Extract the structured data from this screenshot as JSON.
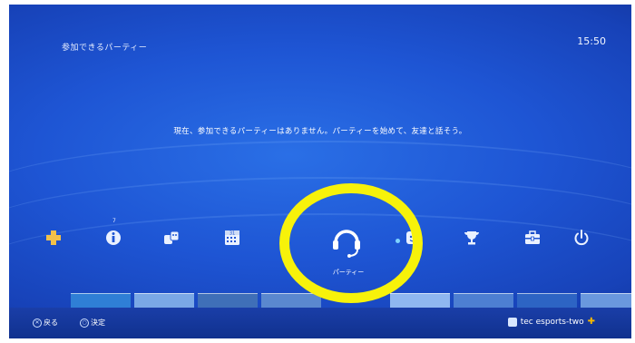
{
  "screen": {
    "title": "参加できるパーティー",
    "clock": "15:50",
    "message": "現在、参加できるパーティーはありません。パーティーを始めて、友達と話そう。"
  },
  "function_bar": {
    "items": [
      {
        "name": "playstation-plus",
        "icon": "plus-icon"
      },
      {
        "name": "notifications",
        "icon": "info-icon",
        "badge": "7"
      },
      {
        "name": "friends",
        "icon": "friends-icon"
      },
      {
        "name": "events",
        "icon": "calendar-icon",
        "label": "31"
      },
      {
        "name": "party",
        "icon": "headset-icon",
        "label": "パーティー",
        "selected": true
      },
      {
        "name": "profile",
        "icon": "profile-icon"
      },
      {
        "name": "trophies",
        "icon": "trophy-icon"
      },
      {
        "name": "settings",
        "icon": "toolbox-icon"
      },
      {
        "name": "power",
        "icon": "power-icon"
      }
    ]
  },
  "bottom_bar": {
    "back_label": "戻る",
    "back_glyph": "✕",
    "enter_label": "決定",
    "enter_glyph": "○",
    "user_name": "tec esports-two",
    "plus_mark": "✚"
  },
  "colors": {
    "background": "#1e55d4",
    "highlight_ring": "#f7f20a",
    "plus_gold": "#f5b800"
  }
}
